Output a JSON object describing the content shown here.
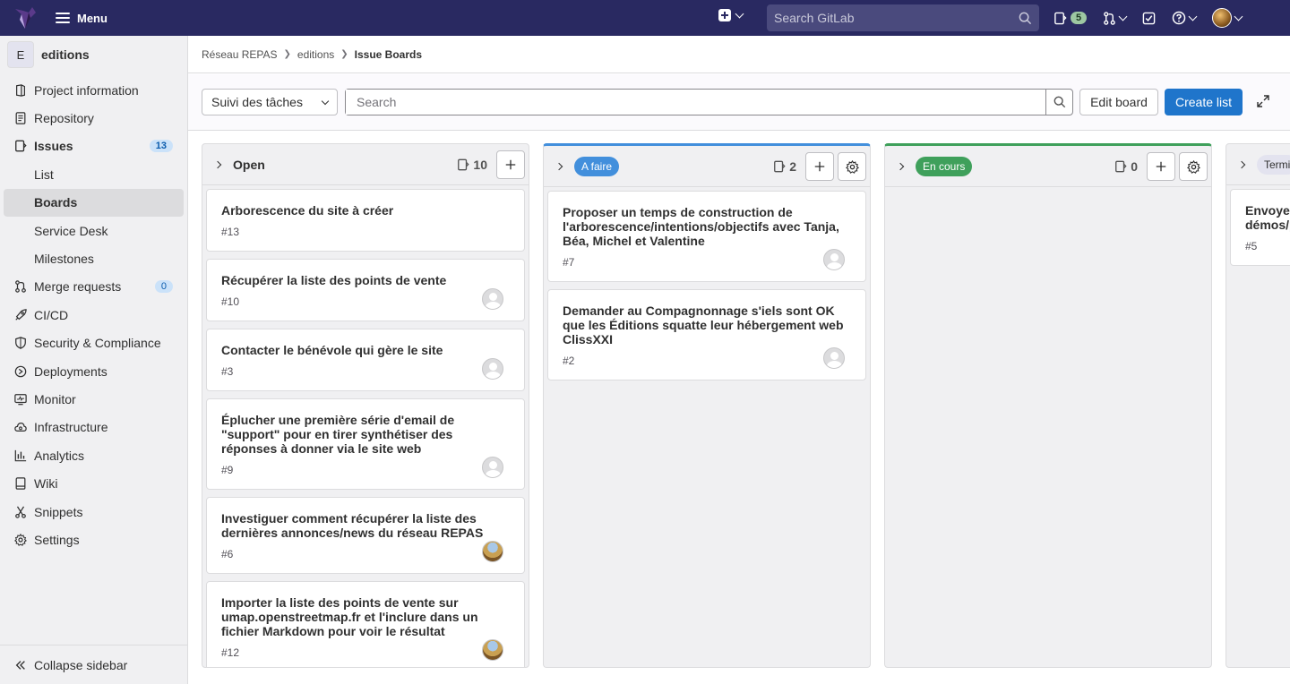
{
  "topbar": {
    "menu_label": "Menu",
    "search_placeholder": "Search GitLab",
    "issues_count": "5",
    "icons": [
      "gitlab-logo",
      "plus-square-icon",
      "search-icon",
      "issues-icon",
      "merge-request-icon",
      "todo-icon",
      "help-icon",
      "avatar"
    ]
  },
  "sidebar": {
    "project_initial": "E",
    "project_name": "editions",
    "items": [
      {
        "label": "Project information",
        "icon": "info-icon"
      },
      {
        "label": "Repository",
        "icon": "doc-icon"
      },
      {
        "label": "Issues",
        "icon": "issues-icon",
        "count": "13"
      },
      {
        "label": "List",
        "sub": true
      },
      {
        "label": "Boards",
        "sub": true,
        "active": true
      },
      {
        "label": "Service Desk",
        "sub": true
      },
      {
        "label": "Milestones",
        "sub": true
      },
      {
        "label": "Merge requests",
        "icon": "merge-request-icon",
        "count": "0"
      },
      {
        "label": "CI/CD",
        "icon": "rocket-icon"
      },
      {
        "label": "Security & Compliance",
        "icon": "shield-icon"
      },
      {
        "label": "Deployments",
        "icon": "deployments-icon"
      },
      {
        "label": "Monitor",
        "icon": "monitor-icon"
      },
      {
        "label": "Infrastructure",
        "icon": "cloud-icon"
      },
      {
        "label": "Analytics",
        "icon": "chart-icon"
      },
      {
        "label": "Wiki",
        "icon": "book-icon"
      },
      {
        "label": "Snippets",
        "icon": "scissors-icon"
      },
      {
        "label": "Settings",
        "icon": "gear-icon"
      }
    ],
    "collapse_label": "Collapse sidebar"
  },
  "breadcrumb": [
    "Réseau REPAS",
    "editions",
    "Issue Boards"
  ],
  "filters": {
    "board_name": "Suivi des tâches",
    "search_placeholder": "Search",
    "edit_board": "Edit board",
    "create_list": "Create list"
  },
  "lists": [
    {
      "title": "Open",
      "count": "10",
      "label_color": "",
      "cards": [
        {
          "title": "Arborescence du site à créer",
          "id": "#13",
          "avatar": "none"
        },
        {
          "title": "Récupérer la liste des points de vente",
          "id": "#10",
          "avatar": "default"
        },
        {
          "title": "Contacter le bénévole qui gère le site",
          "id": "#3",
          "avatar": "default"
        },
        {
          "title": "Éplucher une première série d'email de \"support\" pour en tirer synthétiser des réponses à donner via le site web",
          "id": "#9",
          "avatar": "default"
        },
        {
          "title": "Investiguer comment récupérer la liste des dernières annonces/news du réseau REPAS",
          "id": "#6",
          "avatar": "photo"
        },
        {
          "title": "Importer la liste des points de vente sur umap.openstreetmap.fr et l'inclure dans un fichier Markdown pour voir le résultat",
          "id": "#12",
          "avatar": "photo"
        }
      ]
    },
    {
      "title": "A faire",
      "count": "2",
      "label_color": "#428fdc",
      "cards": [
        {
          "title": "Proposer un temps de construction de l'arborescence/intentions/objectifs avec Tanja, Béa, Michel et Valentine",
          "id": "#7",
          "avatar": "default"
        },
        {
          "title": "Demander au Compagnonnage s'iels sont OK que les Éditions squatte leur hébergement web ClissXXI",
          "id": "#2",
          "avatar": "default"
        }
      ]
    },
    {
      "title": "En cours",
      "count": "0",
      "label_color": "#3fa05b",
      "cards": []
    },
    {
      "title": "Termi",
      "count": "",
      "label_color": "#e3e3ef",
      "cards": [
        {
          "title": "Envoyer démos/p",
          "id": "#5",
          "avatar": "none"
        }
      ]
    }
  ]
}
